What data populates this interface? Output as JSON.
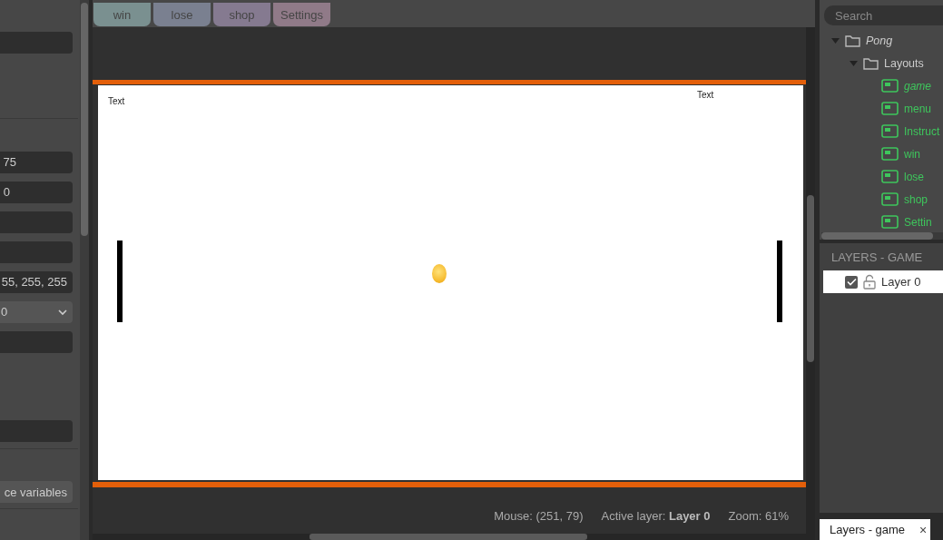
{
  "properties_panel": {
    "sections": [
      {
        "fields": [
          {
            "kind": "input"
          }
        ]
      },
      {
        "fields": [
          {
            "kind": "input",
            "value": "75"
          },
          {
            "kind": "input",
            "value": "0"
          },
          {
            "kind": "input"
          },
          {
            "kind": "input"
          },
          {
            "kind": "input",
            "value": "55, 255, 255"
          },
          {
            "kind": "dropdown",
            "value": "0"
          },
          {
            "kind": "input"
          },
          {
            "kind": "input"
          }
        ]
      },
      {
        "fields": [
          {
            "kind": "button",
            "value": "ce variables"
          }
        ]
      }
    ]
  },
  "layout_tabs": [
    {
      "label": "win",
      "color": "#7a9090",
      "selected": false
    },
    {
      "label": "lose",
      "color": "#7a8090",
      "selected": false
    },
    {
      "label": "shop",
      "color": "#857a90",
      "selected": false
    },
    {
      "label": "Settings",
      "color": "#907a88",
      "selected": false
    }
  ],
  "layout_objects": [
    {
      "kind": "text",
      "text": "Text"
    },
    {
      "kind": "text",
      "text": "Text"
    },
    {
      "kind": "paddle"
    },
    {
      "kind": "paddle"
    },
    {
      "kind": "ball"
    }
  ],
  "status_bar": {
    "mouse": "Mouse: (251, 79)",
    "active_layer": "Active layer: **Layer 0**",
    "zoom": "Zoom: 61%"
  },
  "project": {
    "search": {
      "placeholder": "Search"
    },
    "tree": [
      {
        "kind": "folder",
        "label": "Pong",
        "active": true,
        "expanded": true,
        "children": [
          {
            "kind": "folder",
            "label": "Layouts",
            "active": false,
            "expanded": true,
            "children": [
              {
                "kind": "layout",
                "label": "game",
                "active": true
              },
              {
                "kind": "layout",
                "label": "menu",
                "active": false
              },
              {
                "kind": "layout",
                "label": "Instruct",
                "active": false
              },
              {
                "kind": "layout",
                "label": "win",
                "active": false
              },
              {
                "kind": "layout",
                "label": "lose",
                "active": false
              },
              {
                "kind": "layout",
                "label": "shop",
                "active": false
              },
              {
                "kind": "layout",
                "label": "Settin",
                "active": false
              }
            ]
          }
        ]
      }
    ]
  },
  "layers_panel": {
    "title": "LAYERS - GAME",
    "layers": [
      {
        "name": "Layer 0",
        "visible": true,
        "locked": false,
        "selected": true
      }
    ]
  },
  "bottom_tab": {
    "label": "Layers - game",
    "close": "×"
  }
}
